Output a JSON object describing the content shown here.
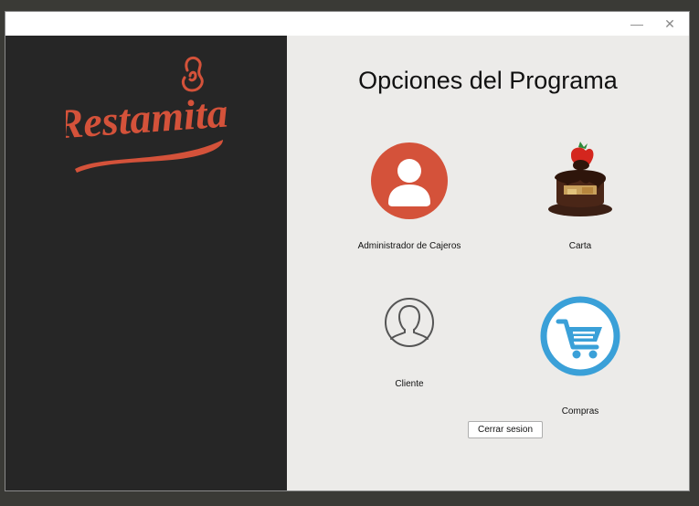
{
  "window": {
    "minimize_glyph": "—",
    "close_glyph": "✕"
  },
  "logo": {
    "text": "Restamita",
    "color": "#d4523a",
    "icon": "flame-icon"
  },
  "main": {
    "title": "Opciones del Programa",
    "options": [
      {
        "label": "Administrador de Cajeros",
        "icon": "user-circle-icon",
        "color": "#d4523a"
      },
      {
        "label": "Carta",
        "icon": "chocolate-cake-icon"
      },
      {
        "label": "Cliente",
        "icon": "person-outline-icon",
        "color": "#555555"
      },
      {
        "label": "Compras",
        "icon": "shopping-cart-icon",
        "color": "#3aa0d8"
      }
    ],
    "logout_label": "Cerrar sesion"
  }
}
